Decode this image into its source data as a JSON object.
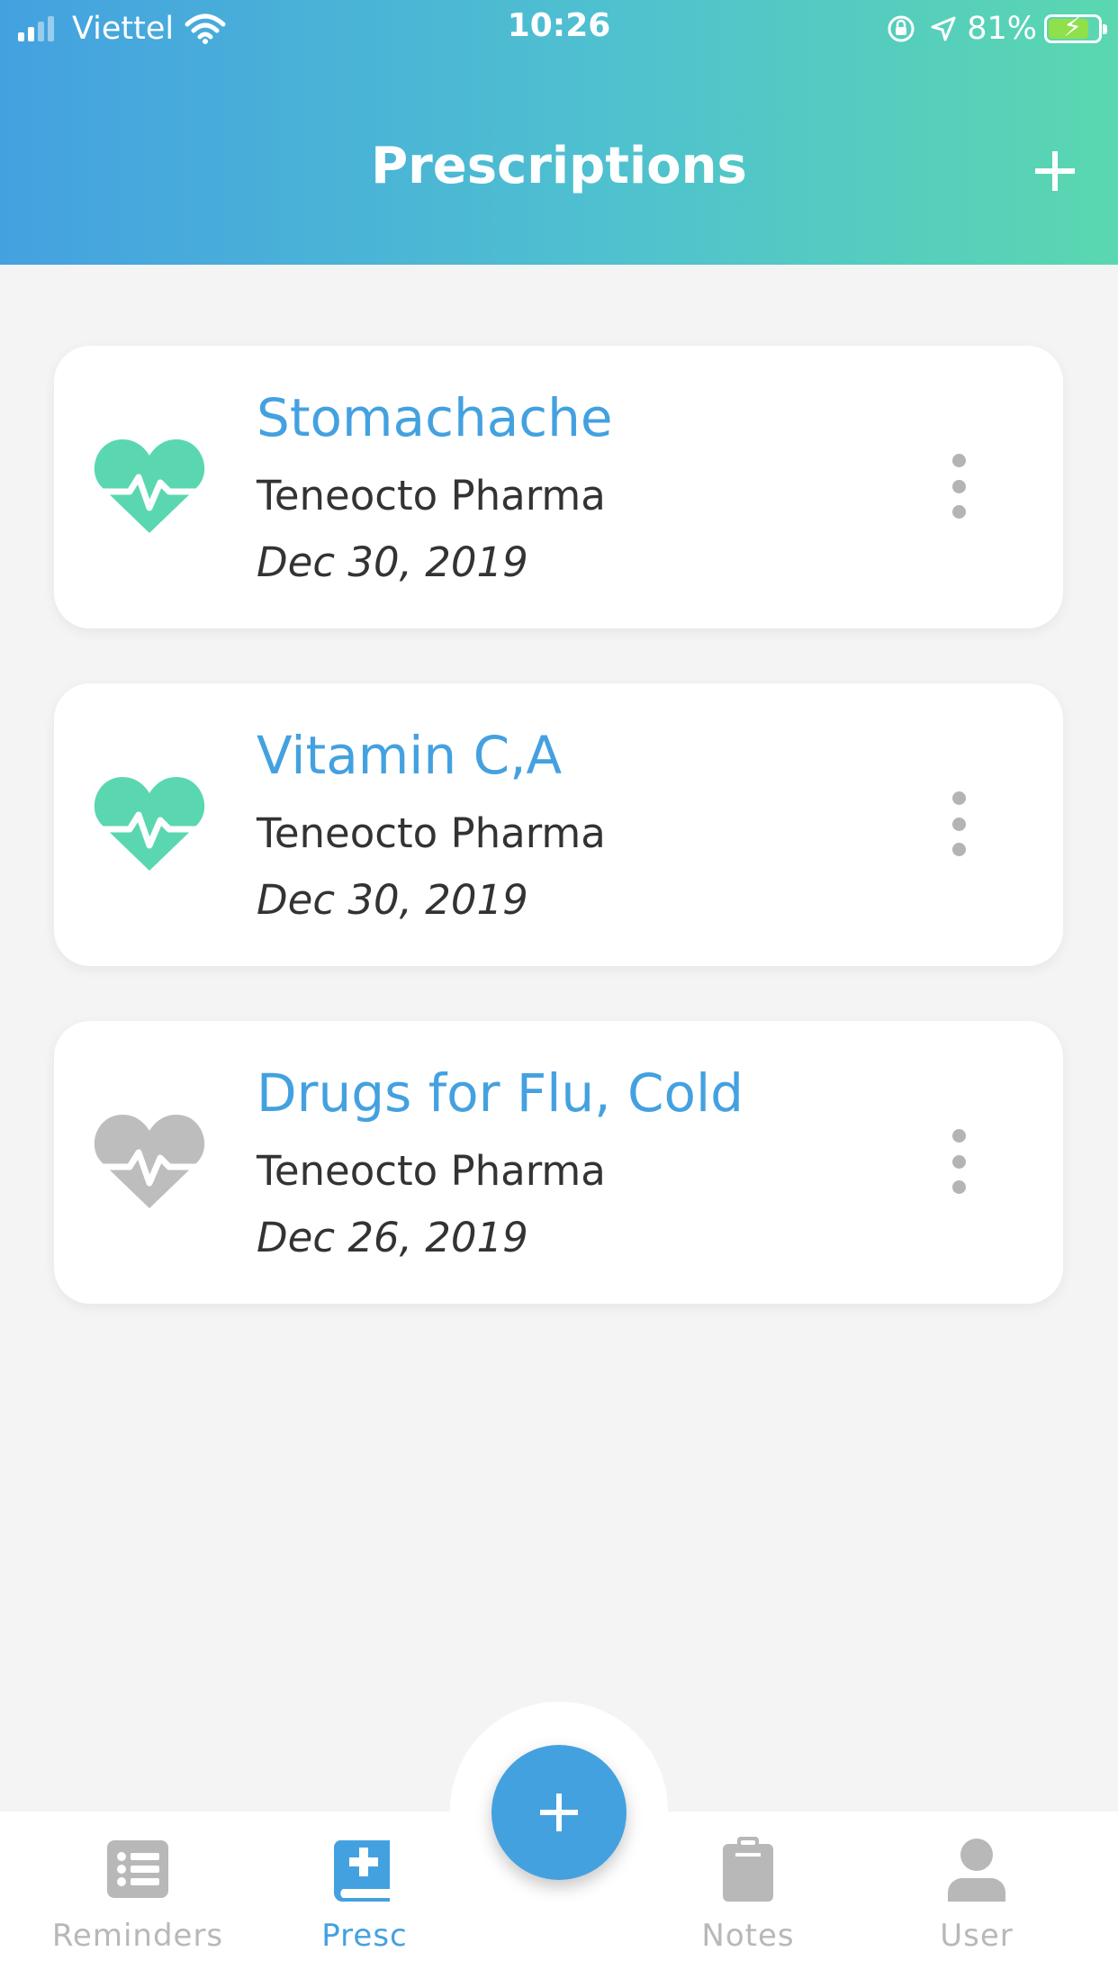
{
  "status_bar": {
    "carrier": "Viettel",
    "time": "10:26",
    "battery": "81%",
    "battery_level": 0.81
  },
  "header": {
    "title": "Prescriptions",
    "add_icon": "plus-icon"
  },
  "colors": {
    "accent": "#44a1e0",
    "active_heart": "#5ad7b0",
    "inactive_heart": "#bdbdbd",
    "header_gradient": [
      "#44a1e0",
      "#5ad7b0"
    ]
  },
  "prescriptions": [
    {
      "title": "Stomachache",
      "company": "Teneocto Pharma",
      "date": "Dec 30, 2019",
      "icon": "heartbeat-icon",
      "active": true
    },
    {
      "title": "Vitamin C,A",
      "company": "Teneocto Pharma",
      "date": "Dec 30, 2019",
      "icon": "heartbeat-icon",
      "active": true
    },
    {
      "title": "Drugs for Flu, Cold",
      "company": "Teneocto Pharma",
      "date": "Dec 26, 2019",
      "icon": "heartbeat-icon",
      "active": false
    }
  ],
  "fab": {
    "icon": "plus-icon"
  },
  "bottom_nav": {
    "items": [
      {
        "label": "Reminders",
        "icon": "list-icon",
        "active": false
      },
      {
        "label": "Presc",
        "icon": "prescription-book-icon",
        "active": true
      },
      {
        "label": "Notes",
        "icon": "clipboard-icon",
        "active": false
      },
      {
        "label": "User",
        "icon": "user-icon",
        "active": false
      }
    ]
  }
}
